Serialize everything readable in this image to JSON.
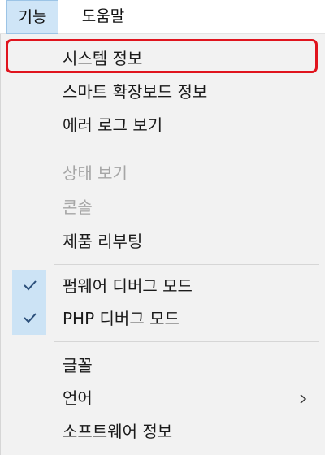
{
  "menubar": {
    "items": [
      {
        "label": "기능",
        "active": true
      },
      {
        "label": "도움말",
        "active": false
      }
    ]
  },
  "menu": {
    "groups": [
      [
        {
          "label": "시스템 정보",
          "highlighted": true
        },
        {
          "label": "스마트 확장보드 정보"
        },
        {
          "label": "에러 로그 보기"
        }
      ],
      [
        {
          "label": "상태 보기",
          "disabled": true
        },
        {
          "label": "콘솔",
          "disabled": true
        },
        {
          "label": "제품 리부팅"
        }
      ],
      [
        {
          "label": "펌웨어 디버그 모드",
          "checked": true
        },
        {
          "label": "PHP 디버그 모드",
          "checked": true
        }
      ],
      [
        {
          "label": "글꼴"
        },
        {
          "label": "언어",
          "submenu": true
        },
        {
          "label": "소프트웨어 정보"
        }
      ]
    ]
  },
  "icons": {
    "check": "checkmark-icon",
    "submenu": "chevron-right-icon"
  },
  "colors": {
    "highlight_border": "#e0141e",
    "check_bg": "#cce3f5",
    "menu_bg": "#f2f2f2",
    "active_menubar_bg": "#cfe5f7",
    "disabled_text": "#a6a6a6"
  }
}
